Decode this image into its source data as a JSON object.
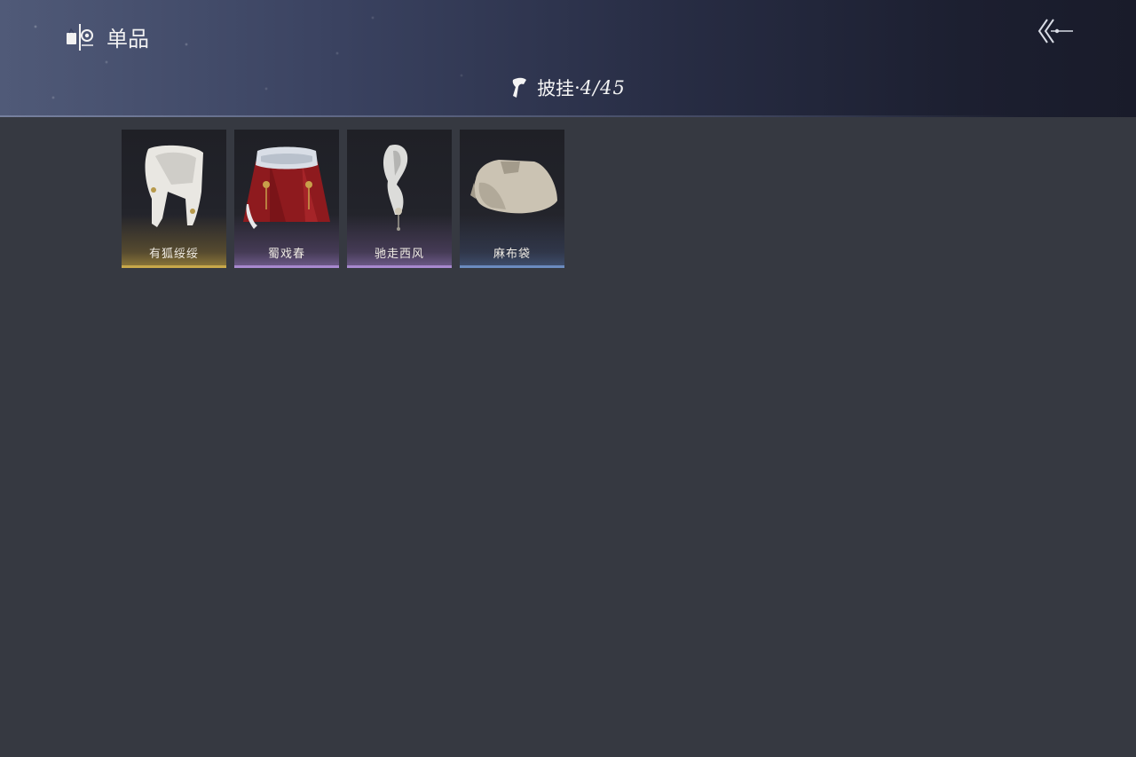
{
  "header": {
    "section_title": "单品",
    "section_icon": "wardrobe-icon",
    "back_icon": "back-arrow-icon"
  },
  "category": {
    "icon": "cape-icon",
    "name": "披挂",
    "separator": "·",
    "count": "4/45"
  },
  "items": [
    {
      "name": "有狐绥绥",
      "rarity_color": "#c8a84a",
      "icon": "white-fur-scarf-icon"
    },
    {
      "name": "蜀戏春",
      "rarity_color": "#a889cf",
      "icon": "red-fur-cape-icon"
    },
    {
      "name": "驰走西风",
      "rarity_color": "#a889cf",
      "icon": "feather-tassel-icon"
    },
    {
      "name": "麻布袋",
      "rarity_color": "#6b8bbf",
      "icon": "linen-sack-icon"
    }
  ],
  "colors": {
    "background": "#363941",
    "header_dark": "#191b2a",
    "text": "#f2f2f2"
  }
}
